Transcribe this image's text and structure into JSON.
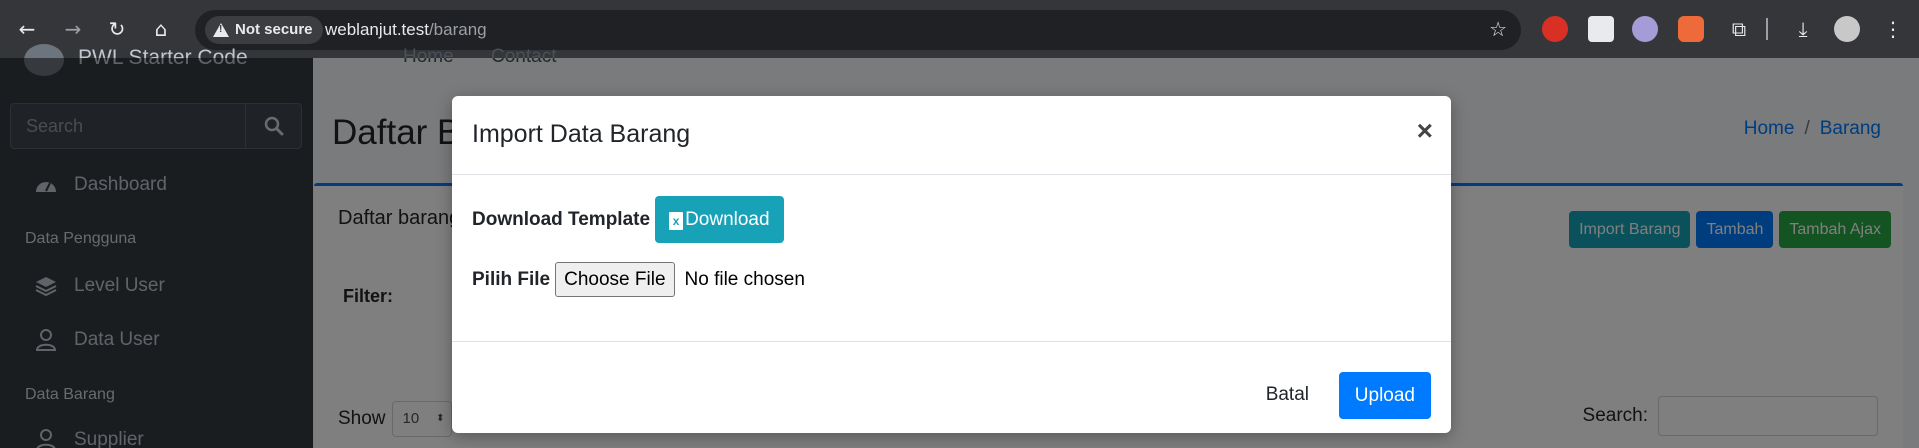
{
  "browser": {
    "security_label": "Not secure",
    "url_host": "weblanjut.test",
    "url_path": "/barang"
  },
  "sidebar": {
    "brand": "PWL Starter Code",
    "search_placeholder": "Search",
    "items": [
      {
        "label": "Dashboard",
        "icon": "tachometer-icon"
      },
      {
        "label": "Level User",
        "icon": "layers-icon"
      },
      {
        "label": "Data User",
        "icon": "user-icon"
      },
      {
        "label": "Supplier",
        "icon": "user-icon"
      }
    ],
    "headers": [
      "Data Pengguna",
      "Data Barang"
    ]
  },
  "topnav": {
    "links": [
      "Home",
      "Contact"
    ]
  },
  "page": {
    "title": "Daftar Barang",
    "breadcrumb": [
      "Home",
      "/",
      "Barang"
    ],
    "card_title": "Daftar barang",
    "buttons": {
      "import": "Import Barang",
      "add": "Tambah",
      "add_ajax": "Tambah Ajax"
    },
    "filter_label": "Filter:",
    "show_label": "Show",
    "show_value": "10",
    "search_label": "Search:"
  },
  "modal": {
    "title": "Import Data Barang",
    "close": "×",
    "download_label": "Download Template",
    "download_button": "Download",
    "file_label": "Pilih File",
    "file_button": "Choose File",
    "file_status": "No file chosen",
    "cancel": "Batal",
    "upload": "Upload"
  },
  "colors": {
    "primary": "#007bff",
    "info": "#17a2b8",
    "success": "#28a745",
    "sidebar": "#343a40"
  }
}
